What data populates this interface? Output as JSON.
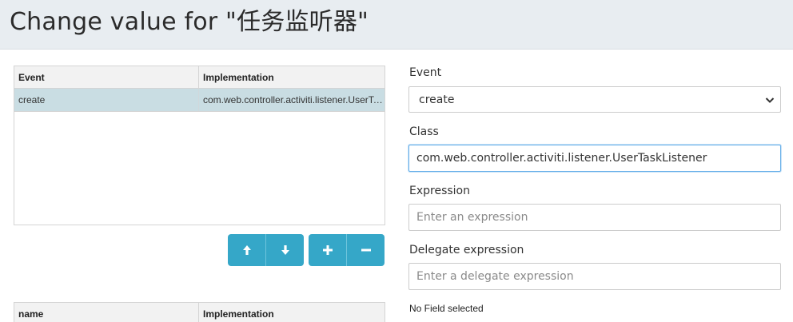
{
  "header": {
    "title": "Change value for \"任务监听器\""
  },
  "listeners_grid": {
    "columns": [
      "Event",
      "Implementation"
    ],
    "rows": [
      {
        "event": "create",
        "implementation": "com.web.controller.activiti.listener.UserTaskListener"
      }
    ]
  },
  "buttons": {
    "move_up_icon": "arrow-up-icon",
    "move_down_icon": "arrow-down-icon",
    "add_icon": "plus-icon",
    "remove_icon": "minus-icon",
    "add_label": "+",
    "remove_label": "−"
  },
  "form": {
    "event_label": "Event",
    "event_value": "create",
    "class_label": "Class",
    "class_value": "com.web.controller.activiti.listener.UserTaskListener",
    "expression_label": "Expression",
    "expression_placeholder": "Enter an expression",
    "delegate_label": "Delegate expression",
    "delegate_placeholder": "Enter a delegate expression"
  },
  "fields_grid": {
    "columns": [
      "name",
      "Implementation"
    ]
  },
  "no_field_text": "No Field selected",
  "colors": {
    "accent": "#35a7c8",
    "selected_row": "#c9dde3",
    "header_bg": "#e8edf1"
  }
}
